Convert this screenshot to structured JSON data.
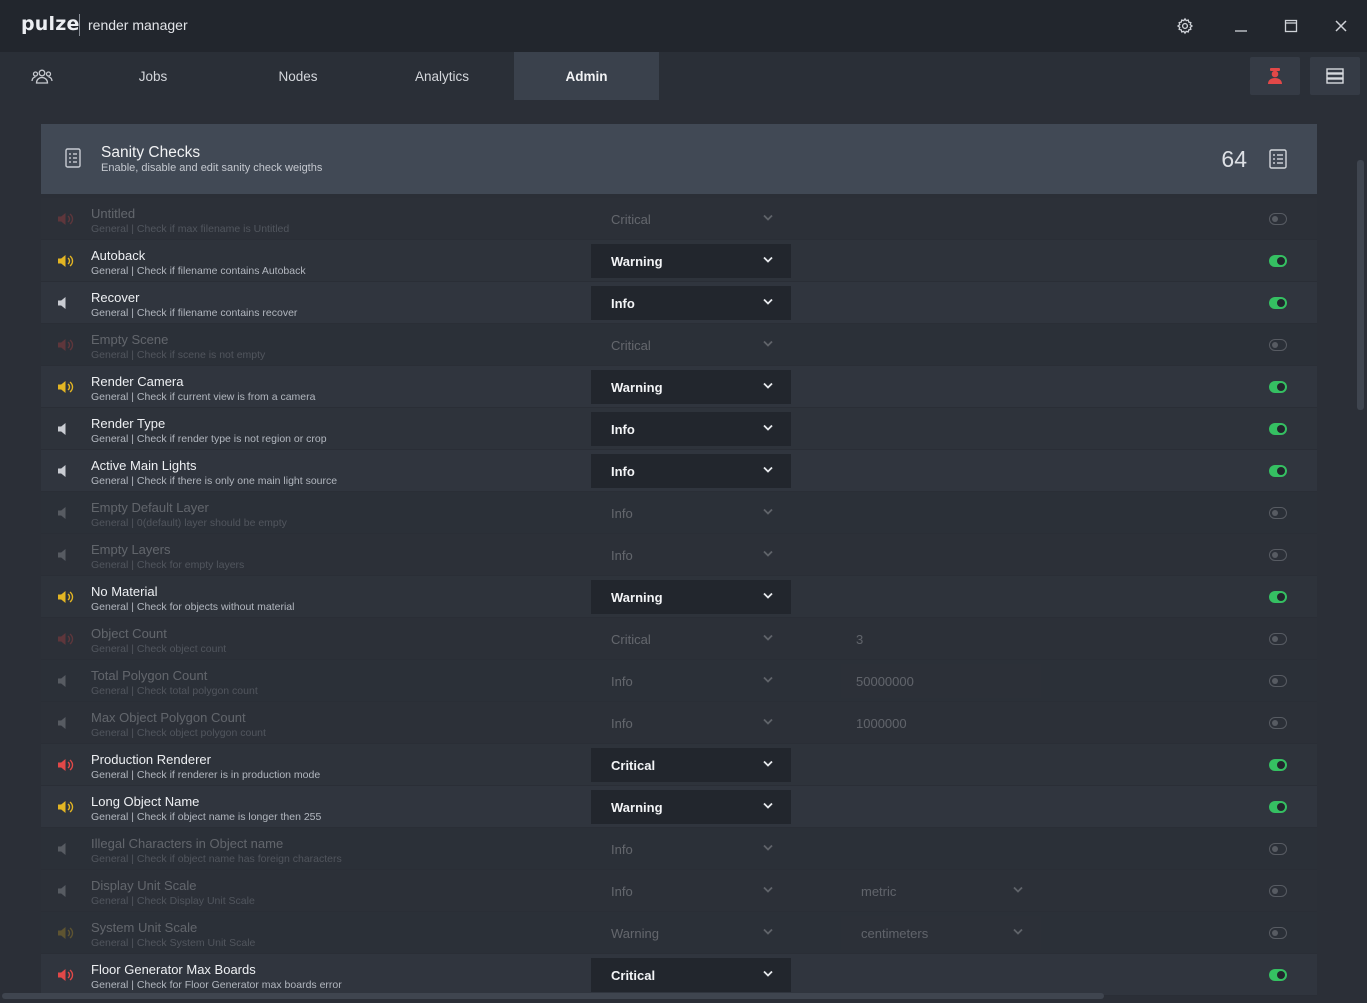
{
  "app": {
    "logo": "pulze",
    "name": "render manager"
  },
  "window": {
    "settings": "gear-icon",
    "minimize": "minimize-icon",
    "maximize": "maximize-icon",
    "close": "close-icon"
  },
  "nav": {
    "tabs": [
      {
        "label": "Jobs",
        "active": false
      },
      {
        "label": "Nodes",
        "active": false
      },
      {
        "label": "Analytics",
        "active": false
      },
      {
        "label": "Admin",
        "active": true
      }
    ]
  },
  "header": {
    "title": "Sanity Checks",
    "subtitle": "Enable, disable and edit sanity check weigths",
    "count": "64"
  },
  "colors": {
    "critical": "#e24848",
    "warning": "#e3b523",
    "info": "#c9ccd2",
    "toggle_on": "#35c062"
  },
  "checks": [
    {
      "title": "Untitled",
      "desc": "General | Check if max filename is Untitled",
      "level": "Critical",
      "enabled": false
    },
    {
      "title": "Autoback",
      "desc": "General | Check if filename contains Autoback",
      "level": "Warning",
      "enabled": true
    },
    {
      "title": "Recover",
      "desc": "General | Check if filename contains recover",
      "level": "Info",
      "enabled": true
    },
    {
      "title": "Empty Scene",
      "desc": "General | Check if scene is not empty",
      "level": "Critical",
      "enabled": false
    },
    {
      "title": "Render Camera",
      "desc": "General | Check if current view is from a camera",
      "level": "Warning",
      "enabled": true
    },
    {
      "title": "Render Type",
      "desc": "General | Check if render type is not region or crop",
      "level": "Info",
      "enabled": true
    },
    {
      "title": "Active Main Lights",
      "desc": "General | Check if there is only one main light source",
      "level": "Info",
      "enabled": true
    },
    {
      "title": "Empty Default Layer",
      "desc": "General | 0(default) layer should be empty",
      "level": "Info",
      "enabled": false
    },
    {
      "title": "Empty Layers",
      "desc": "General | Check for empty layers",
      "level": "Info",
      "enabled": false
    },
    {
      "title": "No Material",
      "desc": "General | Check for objects without material",
      "level": "Warning",
      "enabled": true
    },
    {
      "title": "Object Count",
      "desc": "General | Check object count",
      "level": "Critical",
      "enabled": false,
      "value": "3"
    },
    {
      "title": "Total Polygon Count",
      "desc": "General | Check total polygon count",
      "level": "Info",
      "enabled": false,
      "value": "50000000"
    },
    {
      "title": "Max Object Polygon Count",
      "desc": "General | Check object polygon count",
      "level": "Info",
      "enabled": false,
      "value": "1000000"
    },
    {
      "title": "Production Renderer",
      "desc": "General | Check if renderer is in production mode",
      "level": "Critical",
      "enabled": true
    },
    {
      "title": "Long Object Name",
      "desc": "General | Check if object name is longer then 255",
      "level": "Warning",
      "enabled": true
    },
    {
      "title": "Illegal Characters in Object name",
      "desc": "General | Check if object name has foreign characters",
      "level": "Info",
      "enabled": false
    },
    {
      "title": "Display Unit Scale",
      "desc": "General | Check Display Unit Scale",
      "level": "Info",
      "enabled": false,
      "option": "metric"
    },
    {
      "title": "System Unit Scale",
      "desc": "General | Check System Unit Scale",
      "level": "Warning",
      "enabled": false,
      "option": "centimeters"
    },
    {
      "title": "Floor Generator Max Boards",
      "desc": "General | Check for Floor Generator max boards error",
      "level": "Critical",
      "enabled": true
    }
  ]
}
